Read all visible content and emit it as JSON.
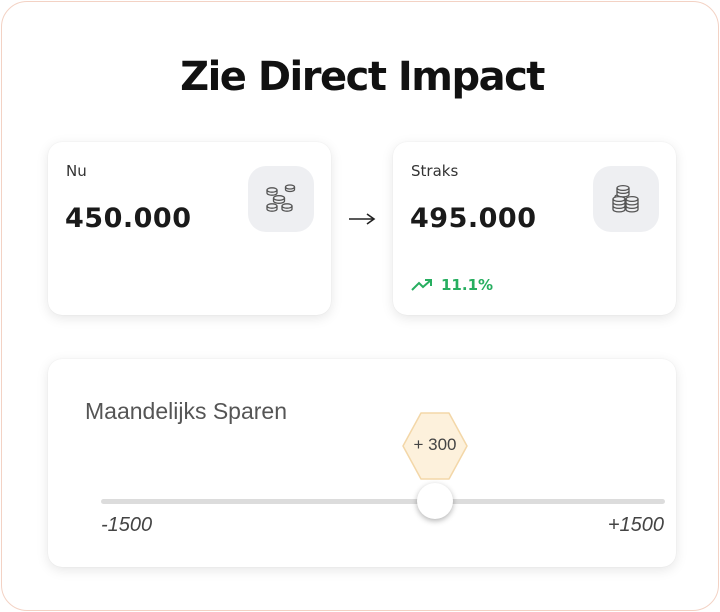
{
  "title": "Zie Direct Impact",
  "now_card": {
    "label": "Nu",
    "value": "450.000",
    "icon": "coins-scattered-icon"
  },
  "later_card": {
    "label": "Straks",
    "value": "495.000",
    "icon": "coin-stack-icon",
    "change": "11.1%",
    "change_icon": "trending-up-icon",
    "change_color": "#27ae60"
  },
  "arrow_icon": "arrow-right-icon",
  "slider": {
    "label": "Maandelijks Sparen",
    "value_label": "+ 300",
    "value": 300,
    "min": -1500,
    "max": 1500,
    "min_label": "-1500",
    "max_label": "+1500",
    "bubble_color": "#fdf1dc"
  },
  "colors": {
    "frame_border": "#f3d2c4",
    "icon_bg": "#eeeff2"
  }
}
